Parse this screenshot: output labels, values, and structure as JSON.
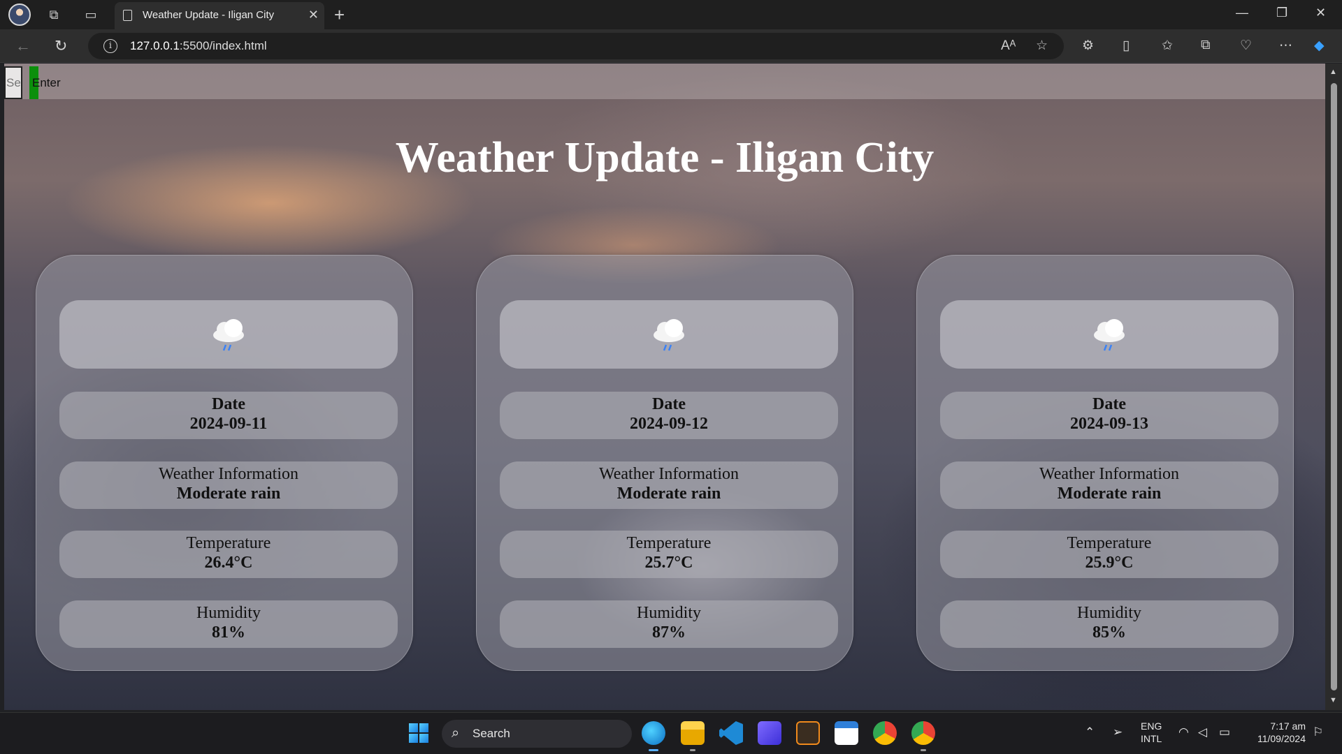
{
  "browser": {
    "tab_title": "Weather Update - Iligan City",
    "url_host": "127.0.0.1",
    "url_rest": ":5500/index.html"
  },
  "search": {
    "placeholder": "Search",
    "button_label": "Enter"
  },
  "page": {
    "title": "Weather Update - Iligan City"
  },
  "forecast": [
    {
      "date_label": "Date",
      "date": "2024-09-11",
      "weather_label": "Weather Information",
      "weather": "Moderate rain",
      "temp_label": "Temperature",
      "temp": "26.4°C",
      "humidity_label": "Humidity",
      "humidity": "81%"
    },
    {
      "date_label": "Date",
      "date": "2024-09-12",
      "weather_label": "Weather Information",
      "weather": "Moderate rain",
      "temp_label": "Temperature",
      "temp": "25.7°C",
      "humidity_label": "Humidity",
      "humidity": "87%"
    },
    {
      "date_label": "Date",
      "date": "2024-09-13",
      "weather_label": "Weather Information",
      "weather": "Moderate rain",
      "temp_label": "Temperature",
      "temp": "25.9°C",
      "humidity_label": "Humidity",
      "humidity": "85%"
    }
  ],
  "taskbar": {
    "search_label": "Search",
    "lang_line1": "ENG",
    "lang_line2": "INTL",
    "time": "7:17 am",
    "date": "11/09/2024"
  },
  "icons": {
    "weather": "rain-cloud-icon"
  },
  "colors": {
    "enter_button": "#0c8f0c",
    "page_title": "#ffffff"
  }
}
